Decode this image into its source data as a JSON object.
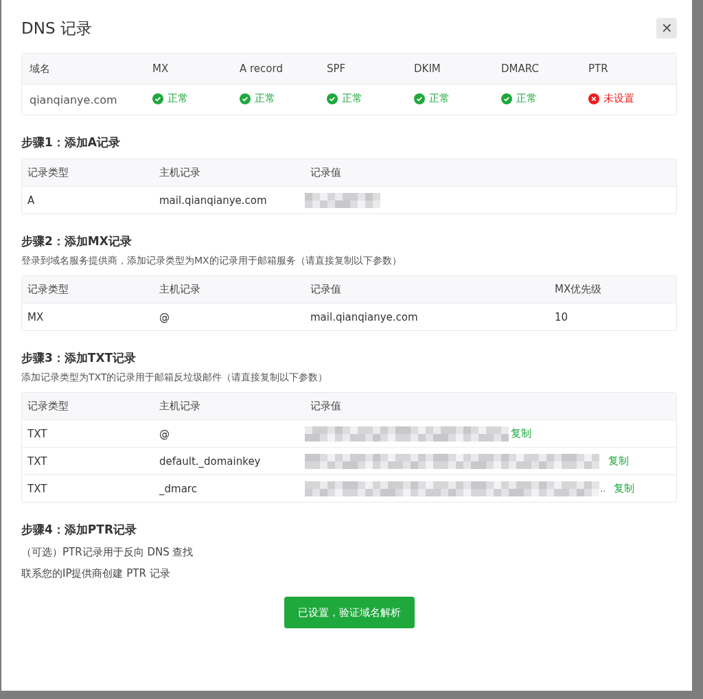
{
  "dialog": {
    "title": "DNS 记录",
    "close": "✕"
  },
  "status_table": {
    "columns": [
      "域名",
      "MX",
      "A record",
      "SPF",
      "DKIM",
      "DMARC",
      "PTR"
    ],
    "domain": "qianqianye.com",
    "statuses": [
      {
        "kind": "ok",
        "label": "正常"
      },
      {
        "kind": "ok",
        "label": "正常"
      },
      {
        "kind": "ok",
        "label": "正常"
      },
      {
        "kind": "ok",
        "label": "正常"
      },
      {
        "kind": "ok",
        "label": "正常"
      },
      {
        "kind": "error",
        "label": "未设置"
      }
    ]
  },
  "steps": [
    {
      "title": "步骤1：添加A记录",
      "columns": [
        "记录类型",
        "主机记录",
        "记录值"
      ],
      "rows": [
        {
          "type": "A",
          "host": "mail.qianqianye.com",
          "redacted": true
        }
      ]
    },
    {
      "title": "步骤2：添加MX记录",
      "description": "登录到域名服务提供商，添加记录类型为MX的记录用于邮箱服务（请直接复制以下参数）",
      "columns": [
        "记录类型",
        "主机记录",
        "记录值",
        "MX优先级"
      ],
      "rows": [
        {
          "type": "MX",
          "host": "@",
          "value": "mail.qianqianye.com",
          "priority": "10"
        }
      ]
    },
    {
      "title": "步骤3：添加TXT记录",
      "description": "添加记录类型为TXT的记录用于邮箱反垃圾邮件（请直接复制以下参数）",
      "columns": [
        "记录类型",
        "主机记录",
        "记录值"
      ],
      "rows": [
        {
          "type": "TXT",
          "host": "@",
          "redacted": true,
          "copy": "复制"
        },
        {
          "type": "TXT",
          "host": "default._domainkey",
          "redacted": true,
          "copy": "复制"
        },
        {
          "type": "TXT",
          "host": "_dmarc",
          "redacted": true,
          "suffix": "..",
          "copy": "复制"
        }
      ]
    },
    {
      "title": "步骤4：添加PTR记录",
      "notes": [
        "（可选）PTR记录用于反向 DNS 查找",
        "联系您的IP提供商创建 PTR 记录"
      ]
    }
  ],
  "verify_button": "已设置，验证域名解析"
}
